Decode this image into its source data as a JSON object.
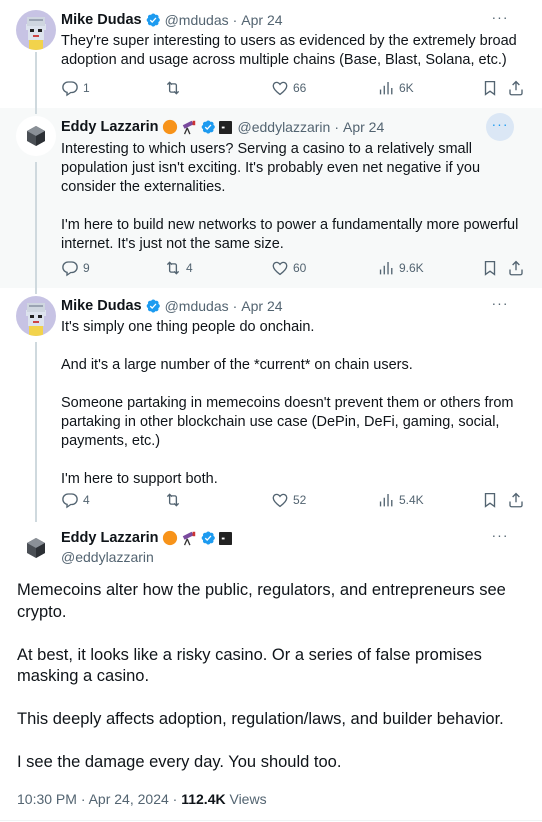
{
  "tweets": [
    {
      "name": "Mike Dudas",
      "handle": "@mdudas",
      "sep": "·",
      "date": "Apr 24",
      "more": "···",
      "paragraphs": [
        "They're super interesting to users as evidenced by the extremely broad adoption and usage across multiple chains (Base, Blast, Solana, etc.)"
      ],
      "replies": "1",
      "reposts": "",
      "likes": "66",
      "views": "6K"
    },
    {
      "name": "Eddy Lazzarin",
      "handle": "@eddylazzarin",
      "sep": "·",
      "date": "Apr 24",
      "more": "···",
      "paragraphs": [
        "Interesting to which users? Serving a casino to a relatively small population just isn't exciting. It's probably even net negative if you consider the externalities.",
        "I'm here to build new networks to power a fundamentally more powerful internet. It's just not the same size."
      ],
      "replies": "9",
      "reposts": "4",
      "likes": "60",
      "views": "9.6K"
    },
    {
      "name": "Mike Dudas",
      "handle": "@mdudas",
      "sep": "·",
      "date": "Apr 24",
      "more": "···",
      "paragraphs": [
        "It's simply one thing people do onchain.",
        "And it's a large number of the *current* on chain users.",
        "Someone partaking in memecoins doesn't prevent them or others from partaking in other blockchain use case (DePin, DeFi, gaming, social, payments, etc.)",
        "I'm here to support both."
      ],
      "replies": "4",
      "reposts": "",
      "likes": "52",
      "views": "5.4K"
    }
  ],
  "main": {
    "name": "Eddy Lazzarin",
    "handle": "@eddylazzarin",
    "more": "···",
    "paragraphs": [
      "Memecoins alter how the public, regulators, and entrepreneurs see crypto.",
      "At best, it looks like a risky casino. Or a series of false promises masking a casino.",
      "This deeply affects adoption, regulation/laws, and builder behavior.",
      "I see the damage every day. You should too."
    ],
    "time": "10:30 PM · Apr 24, 2024 · ",
    "views_count": "112.4K",
    "views_label": " Views"
  },
  "colors": {
    "accent": "#1d9bf0",
    "muted": "#536471",
    "text": "#0f1419",
    "highlight": "#f7f9f9"
  },
  "icons": [
    "verified-badge-icon",
    "orange-circle-emoji-icon",
    "telescope-emoji-icon",
    "a16z-square-icon",
    "reply-icon",
    "repost-icon",
    "like-icon",
    "views-icon",
    "bookmark-icon",
    "share-icon",
    "more-icon"
  ]
}
